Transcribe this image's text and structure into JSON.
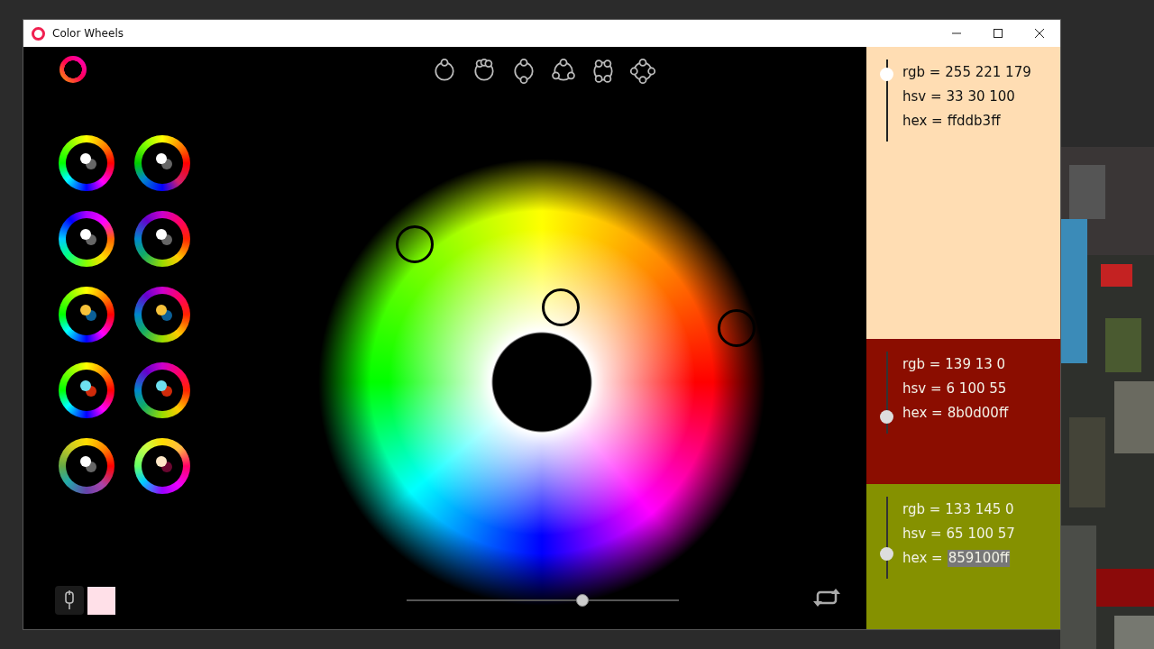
{
  "window": {
    "title": "Color Wheels"
  },
  "swatches": [
    {
      "color": "#ffddb3",
      "dark_text": true,
      "level": 0.82,
      "lines": [
        {
          "label": "rgb =",
          "value": "255 221 179",
          "highlighted": false
        },
        {
          "label": "hsv =",
          "value": "33 30 100",
          "highlighted": false
        },
        {
          "label": "hex =",
          "value": "ffddb3ff",
          "highlighted": false
        }
      ]
    },
    {
      "color": "#8b0d00",
      "dark_text": false,
      "level": 0.21,
      "lines": [
        {
          "label": "rgb =",
          "value": "139 13 0",
          "highlighted": false
        },
        {
          "label": "hsv =",
          "value": "6 100 55",
          "highlighted": false
        },
        {
          "label": "hex =",
          "value": "8b0d00ff",
          "highlighted": false
        }
      ]
    },
    {
      "color": "#859100",
      "dark_text": false,
      "level": 0.31,
      "lines": [
        {
          "label": "rgb =",
          "value": "133 145 0",
          "highlighted": false
        },
        {
          "label": "hsv =",
          "value": "65 100 57",
          "highlighted": false
        },
        {
          "label": "hex =",
          "value": "859100ff",
          "highlighted": true
        }
      ]
    }
  ],
  "picked_color": {
    "color": "#ffe0e8"
  },
  "brightness_slider": {
    "level": 0.645
  }
}
